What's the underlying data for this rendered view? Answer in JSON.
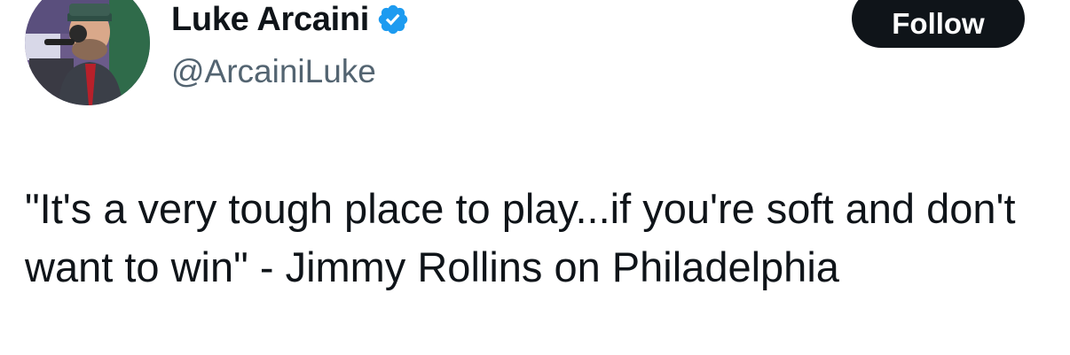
{
  "author": {
    "display_name": "Luke Arcaini",
    "handle": "@ArcainiLuke",
    "verified": true,
    "verified_badge_icon": "verified-badge-icon",
    "avatar_icon": "profile-photo-avatar"
  },
  "actions": {
    "follow_label": "Follow"
  },
  "tweet": {
    "text": "\"It's a very tough place to play...if you're soft and don't want to win\" - Jimmy Rollins on Philadelphia"
  },
  "colors": {
    "text_primary": "#0f1419",
    "text_secondary": "#536471",
    "verified_blue": "#1d9bf0",
    "follow_bg": "#0f1419",
    "follow_text": "#ffffff"
  }
}
